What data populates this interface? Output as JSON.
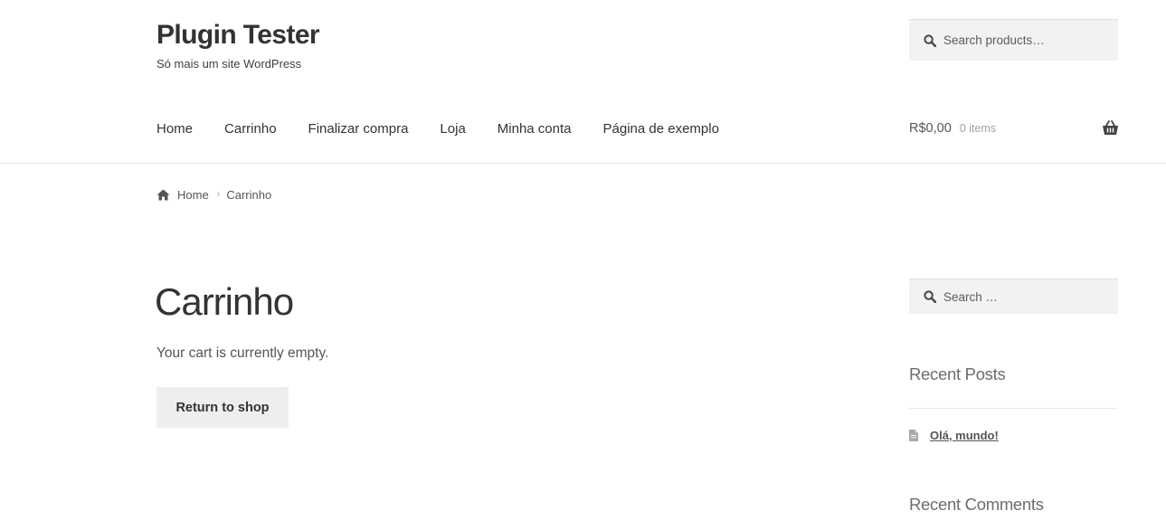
{
  "site": {
    "title": "Plugin Tester",
    "tagline": "Só mais um site WordPress"
  },
  "header_search": {
    "placeholder": "Search products…",
    "icon": "search-icon"
  },
  "nav": {
    "items": [
      {
        "label": "Home"
      },
      {
        "label": "Carrinho"
      },
      {
        "label": "Finalizar compra"
      },
      {
        "label": "Loja"
      },
      {
        "label": "Minha conta"
      },
      {
        "label": "Página de exemplo"
      }
    ]
  },
  "cart": {
    "total": "R$0,00",
    "count": "0 items",
    "icon": "basket-icon"
  },
  "breadcrumb": {
    "home": "Home",
    "separator": "›",
    "current": "Carrinho",
    "icon": "home-icon"
  },
  "page": {
    "heading": "Carrinho",
    "empty_message": "Your cart is currently empty.",
    "return_button": "Return to shop"
  },
  "sidebar": {
    "search_placeholder": "Search …",
    "recent_posts_title": "Recent Posts",
    "posts": [
      {
        "title": "Olá, mundo!",
        "icon": "document-icon"
      }
    ],
    "recent_comments_title": "Recent Comments"
  },
  "colors": {
    "text": "#333333",
    "muted": "#6d6d6d",
    "search_bg": "#f2f2f2",
    "button_bg": "#eeeeee"
  }
}
